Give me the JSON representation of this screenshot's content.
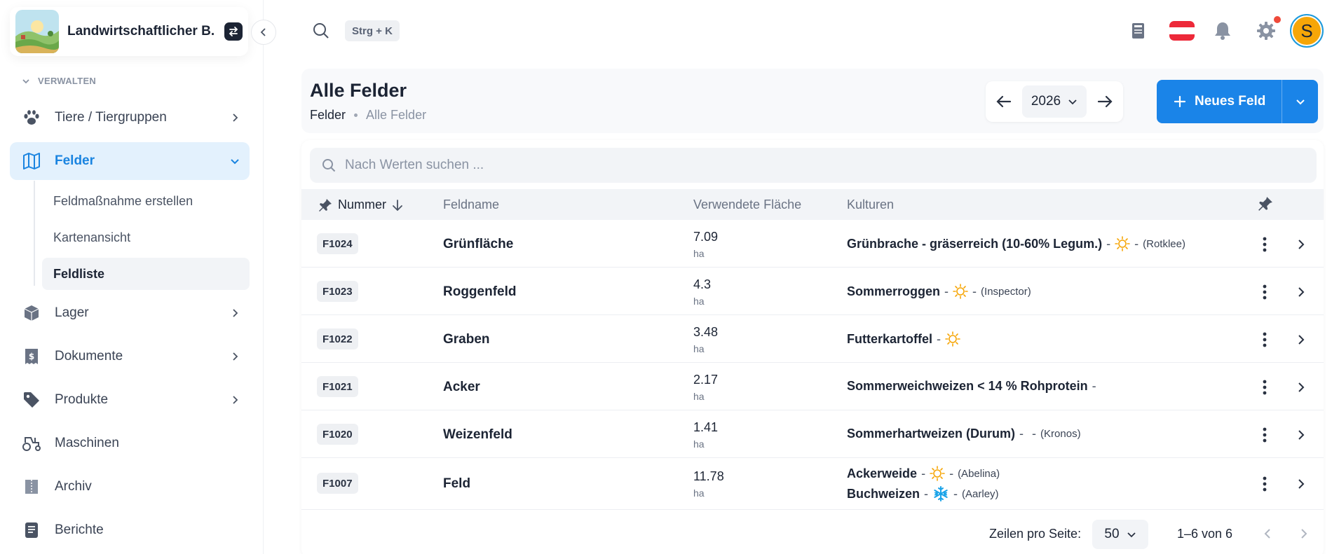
{
  "farm": {
    "name": "Landwirtschaftlicher B..."
  },
  "sidebar": {
    "section_label": "VERWALTEN",
    "items": [
      {
        "label": "Tiere / Tiergruppen",
        "icon": "paw-icon"
      },
      {
        "label": "Felder",
        "icon": "map-icon"
      },
      {
        "label": "Lager",
        "icon": "box-icon"
      },
      {
        "label": "Dokumente",
        "icon": "document-dollar-icon"
      },
      {
        "label": "Produkte",
        "icon": "tag-icon"
      },
      {
        "label": "Maschinen",
        "icon": "tractor-icon"
      },
      {
        "label": "Archiv",
        "icon": "archive-icon"
      },
      {
        "label": "Berichte",
        "icon": "report-icon"
      }
    ],
    "sub_items": [
      {
        "label": "Feldmaßnahme erstellen"
      },
      {
        "label": "Kartenansicht"
      },
      {
        "label": "Feldliste"
      }
    ]
  },
  "topbar": {
    "shortcut": "Strg + K",
    "avatar_initial": "S"
  },
  "header": {
    "title": "Alle Felder",
    "breadcrumb": [
      "Felder",
      "Alle Felder"
    ],
    "year": "2026",
    "new_button": "Neues Feld"
  },
  "search": {
    "placeholder": "Nach Werten suchen ..."
  },
  "table": {
    "columns": [
      "Nummer",
      "Feldname",
      "Verwendete Fläche",
      "Kulturen"
    ],
    "rows": [
      {
        "number": "F1024",
        "name": "Grünfläche",
        "area": "7.09",
        "unit": "ha",
        "cultures": [
          {
            "name": "Grünbrache - gräserreich (10-60% Legum.)",
            "season": "sun-icon",
            "variety": "(Rotklee)"
          }
        ]
      },
      {
        "number": "F1023",
        "name": "Roggenfeld",
        "area": "4.3",
        "unit": "ha",
        "cultures": [
          {
            "name": "Sommerroggen",
            "season": "sun-icon",
            "variety": "(Inspector)"
          }
        ]
      },
      {
        "number": "F1022",
        "name": "Graben",
        "area": "3.48",
        "unit": "ha",
        "cultures": [
          {
            "name": "Futterkartoffel",
            "season": "sun-icon",
            "variety": ""
          }
        ]
      },
      {
        "number": "F1021",
        "name": "Acker",
        "area": "2.17",
        "unit": "ha",
        "cultures": [
          {
            "name": "Sommerweichweizen < 14 % Rohprotein",
            "season": "",
            "variety": ""
          }
        ]
      },
      {
        "number": "F1020",
        "name": "Weizenfeld",
        "area": "1.41",
        "unit": "ha",
        "cultures": [
          {
            "name": "Sommerhartweizen (Durum)",
            "season": "",
            "variety": "(Kronos)"
          }
        ]
      },
      {
        "number": "F1007",
        "name": "Feld",
        "area": "11.78",
        "unit": "ha",
        "cultures": [
          {
            "name": "Ackerweide",
            "season": "sun-icon",
            "variety": "(Abelina)"
          },
          {
            "name": "Buchweizen",
            "season": "snowflake-icon",
            "variety": "(Aarley)"
          }
        ]
      }
    ]
  },
  "footer": {
    "rows_per_page_label": "Zeilen pro Seite:",
    "rows_per_page": "50",
    "range": "1–6 von 6"
  },
  "colors": {
    "primary": "#1a84e8",
    "accent_sun": "#f6a608",
    "accent_snow": "#1aa3e8",
    "notification": "#ef4a3a"
  }
}
